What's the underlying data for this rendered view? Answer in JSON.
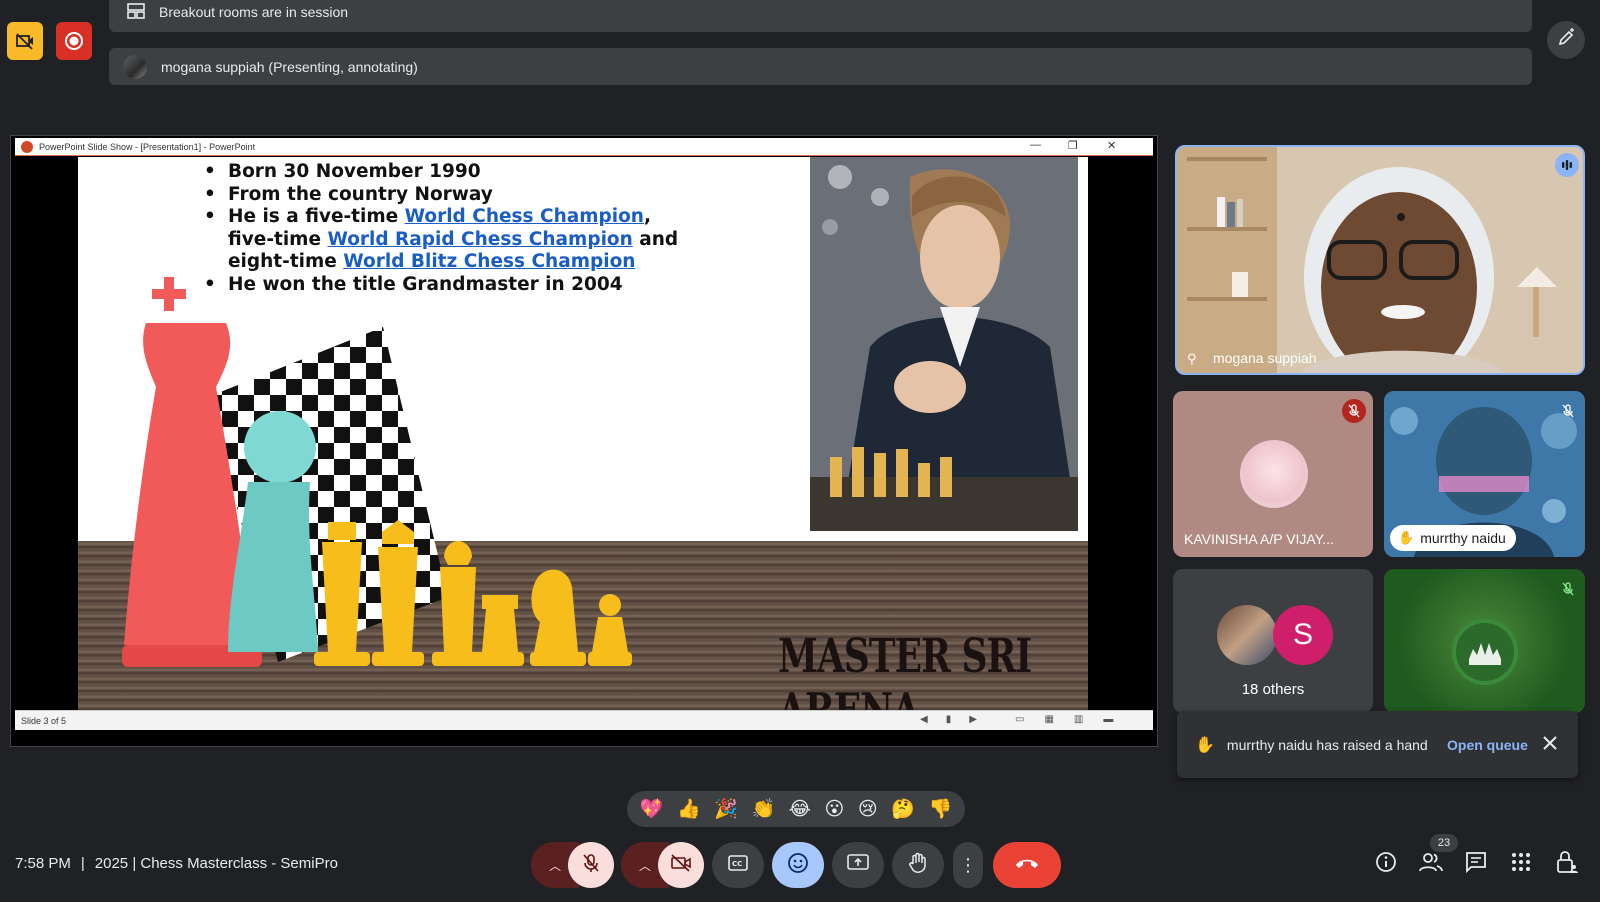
{
  "banners": {
    "breakout": "Breakout rooms are in session",
    "presenting": "mogana suppiah (Presenting, annotating)"
  },
  "ppt": {
    "window_title": "PowerPoint Slide Show - [Presentation1] - PowerPoint",
    "status": "Slide 3 of 5",
    "bullets": {
      "b1": "Born 30 November 1990",
      "b2": "From the country Norway",
      "b3_pre": "He is a five-time ",
      "b3_link1": "World Chess Champion",
      "b3_mid1": ",",
      "b3_mid2": "five-time ",
      "b3_link2": "World Rapid Chess Champion",
      "b3_mid3": " and",
      "b3_mid4": "eight-time ",
      "b3_link3": "World Blitz Chess Champion",
      "b4": "He won the title Grandmaster in 2004"
    },
    "arena_text": "MASTER SRI ARENA"
  },
  "tiles": {
    "mogana": "mogana suppiah",
    "kavinisha": "KAVINISHA A/P VIJAY...",
    "murrthy": "murrthy naidu",
    "others_initial": "S",
    "others_label": "18 others"
  },
  "toast": {
    "message": "murrthy naidu has raised a hand",
    "action": "Open queue"
  },
  "reactions": [
    "💖",
    "👍",
    "🎉",
    "👏",
    "😂",
    "😮",
    "😢",
    "🤔",
    "👎"
  ],
  "bottom": {
    "time": "7:58 PM",
    "separator": "|",
    "meeting_title": "2025 | Chess Masterclass - SemiPro",
    "people_count": "23"
  },
  "colors": {
    "accent_blue": "#8ab4f8",
    "end_call_red": "#ea4335",
    "rec_red": "#d93025",
    "warn_yellow": "#f9ba2a",
    "avatar_s": "#d01f6a"
  }
}
